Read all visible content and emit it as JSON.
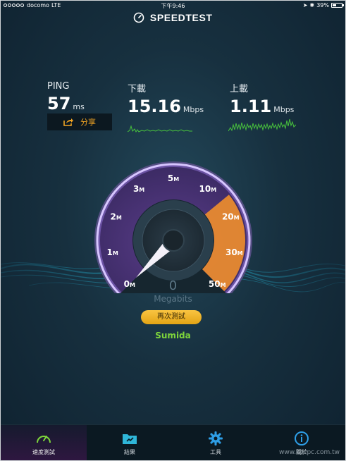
{
  "status_bar": {
    "carrier": "docomo",
    "network": "LTE",
    "time": "下午9:46",
    "battery": "39%"
  },
  "header": {
    "logo_text": "SPEEDTEST"
  },
  "metrics": {
    "ping": {
      "label": "PING",
      "value": "57",
      "unit": "ms"
    },
    "download": {
      "label": "下載",
      "value": "15.16",
      "unit": "Mbps"
    },
    "upload": {
      "label": "上載",
      "value": "1.11",
      "unit": "Mbps"
    }
  },
  "share": {
    "label": "分享"
  },
  "gauge": {
    "ticks": [
      {
        "n": "0",
        "u": "M"
      },
      {
        "n": "1",
        "u": "M"
      },
      {
        "n": "2",
        "u": "M"
      },
      {
        "n": "3",
        "u": "M"
      },
      {
        "n": "5",
        "u": "M"
      },
      {
        "n": "10",
        "u": "M"
      },
      {
        "n": "20",
        "u": "M"
      },
      {
        "n": "30",
        "u": "M"
      },
      {
        "n": "50",
        "u": "M"
      }
    ],
    "current_value": 0
  },
  "readout": {
    "value": "0",
    "unit": "Megabits"
  },
  "retest_button": {
    "label": "再次測試"
  },
  "server": {
    "name": "Sumida"
  },
  "tabs": [
    {
      "label": "速度測試",
      "icon": "gauge-icon",
      "active": true
    },
    {
      "label": "結果",
      "icon": "folder-icon",
      "active": false
    },
    {
      "label": "工具",
      "icon": "gear-icon",
      "active": false
    },
    {
      "label": "關於",
      "icon": "info-icon",
      "active": false
    }
  ],
  "watermark": {
    "text": "www.kocpc.com.tw"
  },
  "colors": {
    "accent_orange": "#f5a623",
    "retest_yellow": "#f2b62a",
    "server_green": "#7ed63b",
    "spark_green": "#48c23d",
    "tools_blue": "#2e9ee6"
  }
}
